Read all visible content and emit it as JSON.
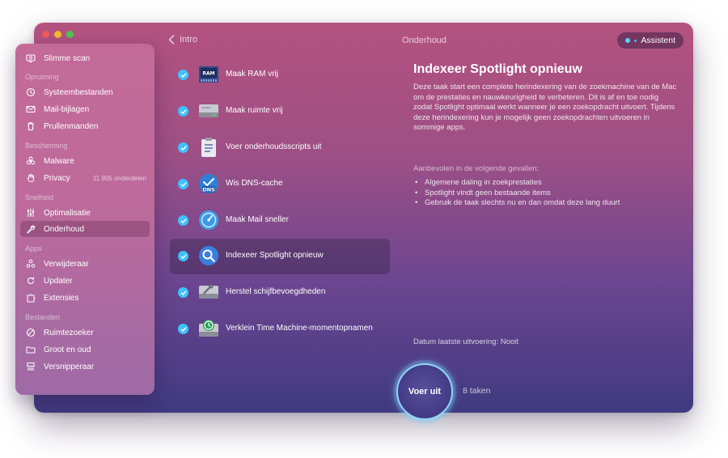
{
  "window": {
    "back_label": "Intro",
    "title": "Onderhoud",
    "assistant_label": "Assistent"
  },
  "sidebar": {
    "top_item": {
      "label": "Slimme scan",
      "icon": "smart-scan-icon"
    },
    "sections": [
      {
        "heading": "Opruiming",
        "items": [
          {
            "label": "Systeembestanden",
            "icon": "system-junk-icon"
          },
          {
            "label": "Mail-bijlagen",
            "icon": "mail-icon"
          },
          {
            "label": "Prullenmanden",
            "icon": "trash-icon"
          }
        ]
      },
      {
        "heading": "Bescherming",
        "items": [
          {
            "label": "Malware",
            "icon": "biohazard-icon"
          },
          {
            "label": "Privacy",
            "icon": "hand-icon",
            "extra": "11.905 onderdelen"
          }
        ]
      },
      {
        "heading": "Snelheid",
        "items": [
          {
            "label": "Optimalisatie",
            "icon": "sliders-icon"
          },
          {
            "label": "Onderhoud",
            "icon": "wrench-icon",
            "active": true
          }
        ]
      },
      {
        "heading": "Apps",
        "items": [
          {
            "label": "Verwijderaar",
            "icon": "uninstaller-icon"
          },
          {
            "label": "Updater",
            "icon": "updater-icon"
          },
          {
            "label": "Extensies",
            "icon": "extensions-icon"
          }
        ]
      },
      {
        "heading": "Bestanden",
        "items": [
          {
            "label": "Ruimtezoeker",
            "icon": "space-lens-icon"
          },
          {
            "label": "Groot en oud",
            "icon": "folder-icon"
          },
          {
            "label": "Versnipperaar",
            "icon": "shredder-icon"
          }
        ]
      }
    ]
  },
  "tasks": [
    {
      "label": "Maak RAM vrij",
      "icon": "ram-icon",
      "checked": true
    },
    {
      "label": "Maak ruimte vrij",
      "icon": "drive-icon",
      "checked": true
    },
    {
      "label": "Voer onderhoudsscripts uit",
      "icon": "clipboard-icon",
      "checked": true
    },
    {
      "label": "Wis DNS-cache",
      "icon": "dns-icon",
      "checked": true,
      "icon_text": "DNS"
    },
    {
      "label": "Maak Mail sneller",
      "icon": "mail-speed-icon",
      "checked": true
    },
    {
      "label": "Indexeer Spotlight opnieuw",
      "icon": "spotlight-icon",
      "checked": true,
      "selected": true
    },
    {
      "label": "Herstel schijfbevoegdheden",
      "icon": "disk-repair-icon",
      "checked": true
    },
    {
      "label": "Verklein Time Machine-momentopnamen",
      "icon": "time-machine-icon",
      "checked": true
    }
  ],
  "detail": {
    "title": "Indexeer Spotlight opnieuw",
    "description": "Deze taak start een complete herindexering van de zoekmachine van de Mac om de prestaties en nauwkeurigheid te verbeteren. Dit is af en toe nodig zodat Spotlight optimaal werkt wanneer je een zoekopdracht uitvoert. Tijdens deze herindexering kun je mogelijk geen zoekopdrachten uitvoeren in sommige apps.",
    "recommended_heading": "Aanbevolen in de volgende gevallen:",
    "recommended": [
      "Algemene daling in zoekprestaties",
      "Spotlight vindt geen bestaande items",
      "Gebruik de taak slechts nu en dan omdat deze lang duurt"
    ],
    "last_run": "Datum laatste uitvoering:  Nooit"
  },
  "run": {
    "button_label": "Voer uit",
    "count_label": "8 taken"
  },
  "colors": {
    "accent": "#3ec1ff",
    "window_top": "#b4527f",
    "window_bottom": "#3f3a80",
    "sidebar": "#c36a97"
  }
}
